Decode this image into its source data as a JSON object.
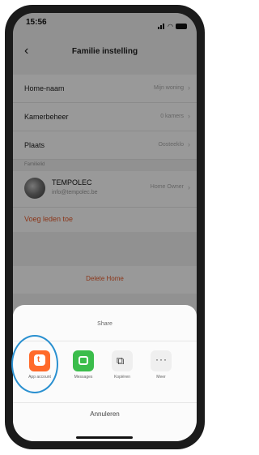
{
  "status": {
    "time": "15:56"
  },
  "nav": {
    "title": "Familie instelling"
  },
  "settings": [
    {
      "label": "Home-naam",
      "value": "Mijn woning"
    },
    {
      "label": "Kamerbeheer",
      "value": "0 kamers"
    },
    {
      "label": "Plaats",
      "value": "Oosteeklo"
    }
  ],
  "family": {
    "section_label": "Familielid",
    "member": {
      "name": "TEMPOLEC",
      "email": "info@tempolec.be",
      "role": "Home Owner"
    },
    "add_label": "Voeg leden toe"
  },
  "delete_label": "Delete Home",
  "share_sheet": {
    "title": "Share",
    "items": [
      {
        "label": "App account",
        "icon": "app-account-icon"
      },
      {
        "label": "Messages",
        "icon": "messages-icon"
      },
      {
        "label": "Kopiëren",
        "icon": "copy-icon"
      },
      {
        "label": "Meer",
        "icon": "more-icon"
      }
    ],
    "cancel_label": "Annuleren"
  },
  "colors": {
    "accent": "#e85a2a",
    "tuya": "#ff6a2a",
    "messages": "#3bbd4b",
    "highlight": "#2a90d0"
  }
}
